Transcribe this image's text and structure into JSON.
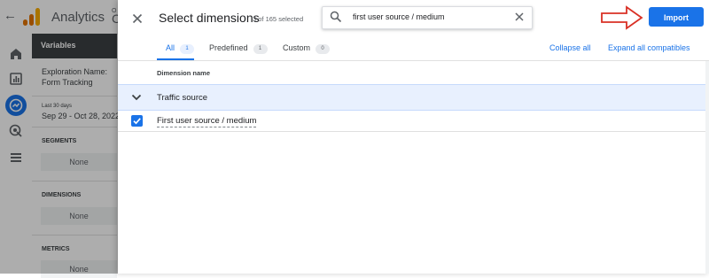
{
  "background": {
    "app_title": "Analytics",
    "property_line1": "O",
    "property_line2": "C",
    "variables_title": "Variables",
    "exploration_label": "Exploration Name:",
    "exploration_name": "Form Tracking",
    "date_preset": "Last 30 days",
    "date_range": "Sep 29 - Oct 28, 2022",
    "segments_label": "SEGMENTS",
    "segments_value": "None",
    "dimensions_label": "DIMENSIONS",
    "dimensions_value": "None",
    "metrics_label": "METRICS",
    "metrics_value": "None",
    "logo_colors": [
      "#f9ab00",
      "#e37400",
      "#e37400"
    ],
    "rail_icons": [
      "home-icon",
      "reports-icon",
      "explore-icon",
      "advertising-icon",
      "configure-icon"
    ]
  },
  "dialog": {
    "title": "Select dimensions",
    "selected_count": "3 of 165 selected",
    "search": {
      "value": "first user source / medium"
    },
    "import_label": "Import",
    "tabs": [
      {
        "label": "All",
        "count": "1"
      },
      {
        "label": "Predefined",
        "count": "1"
      },
      {
        "label": "Custom",
        "count": "0"
      }
    ],
    "active_tab": "All",
    "collapse_all": "Collapse all",
    "expand_all": "Expand all compatibles",
    "column_header": "Dimension name",
    "group": {
      "label": "Traffic source",
      "expanded": true
    },
    "items": [
      {
        "label": "First user source / medium",
        "checked": true
      }
    ]
  },
  "colors": {
    "accent": "#1a73e8",
    "arrow": "#d93025",
    "group_row": "#e8f0fe"
  }
}
